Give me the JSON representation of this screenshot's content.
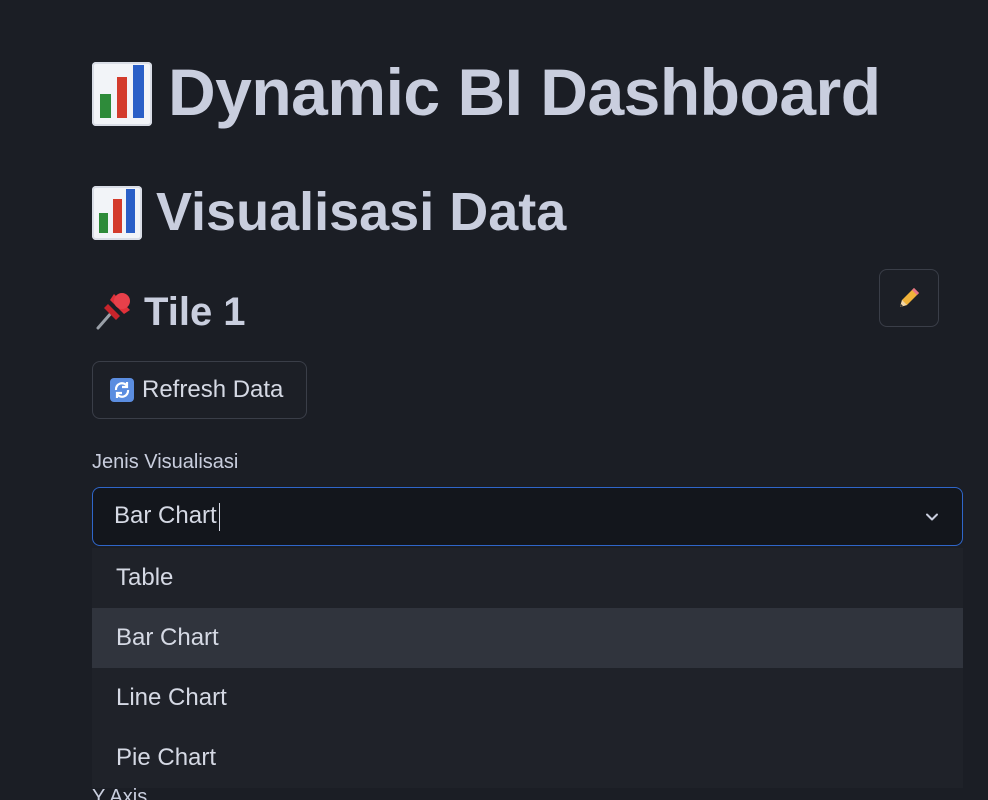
{
  "header": {
    "title": "Dynamic BI Dashboard",
    "title_icon": "bar-chart-emoji"
  },
  "section": {
    "title": "Visualisasi Data",
    "icon": "bar-chart-emoji"
  },
  "tile": {
    "title": "Tile 1",
    "icon": "pushpin-emoji",
    "edit_icon": "pencil-emoji"
  },
  "refresh_button": {
    "label": "Refresh Data",
    "icon": "refresh-emoji"
  },
  "visualization_select": {
    "label": "Jenis Visualisasi",
    "value": "Bar Chart",
    "options": [
      "Table",
      "Bar Chart",
      "Line Chart",
      "Pie Chart"
    ],
    "highlighted": "Bar Chart"
  },
  "next_field": {
    "label": "Y Axis"
  },
  "colors": {
    "background": "#1b1e25",
    "text": "#c9cede",
    "focus_border": "#2f66c9",
    "dropdown_bg": "#1f2229",
    "dropdown_highlight": "#30343d"
  }
}
